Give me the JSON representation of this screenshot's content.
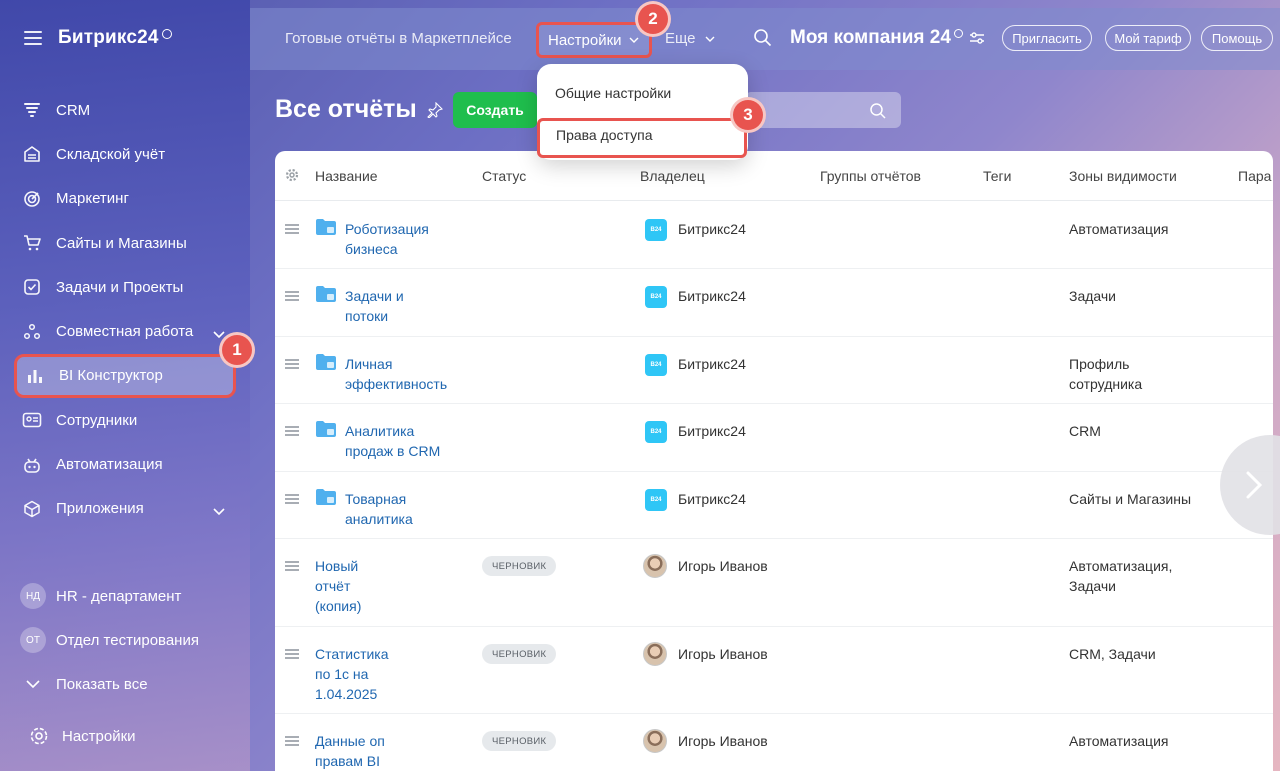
{
  "app": {
    "logo": "Битрикс24"
  },
  "sidebar": {
    "items": [
      {
        "label": "CRM",
        "icon": "crm-icon"
      },
      {
        "label": "Складской учёт",
        "icon": "warehouse-icon"
      },
      {
        "label": "Маркетинг",
        "icon": "marketing-icon"
      },
      {
        "label": "Сайты и Магазины",
        "icon": "cart-icon"
      },
      {
        "label": "Задачи и Проекты",
        "icon": "checkbox-icon"
      },
      {
        "label": "Совместная работа",
        "icon": "collab-icon"
      },
      {
        "label": "BI Конструктор",
        "icon": "bar-chart-icon"
      },
      {
        "label": "Сотрудники",
        "icon": "employees-icon"
      },
      {
        "label": "Автоматизация",
        "icon": "robot-icon"
      },
      {
        "label": "Приложения",
        "icon": "cube-icon"
      }
    ],
    "groups": [
      {
        "initials": "НД",
        "label": "HR - департамент"
      },
      {
        "initials": "ОТ",
        "label": "Отдел тестирования"
      }
    ],
    "show_all": "Показать все",
    "settings": "Настройки"
  },
  "topbar": {
    "marketplace": "Готовые отчёты в Маркетплейсе",
    "settings": "Настройки",
    "more": "Еще",
    "company": "Моя компания 24",
    "invite": "Пригласить",
    "tariff": "Мой тариф",
    "help": "Помощь"
  },
  "main": {
    "title": "Все отчёты",
    "create": "Создать"
  },
  "dropdown": {
    "general": "Общие настройки",
    "access": "Права доступа"
  },
  "callouts": {
    "one": "1",
    "two": "2",
    "three": "3"
  },
  "table": {
    "headers": [
      "Название",
      "Статус",
      "Владелец",
      "Группы отчётов",
      "Теги",
      "Зоны видимости",
      "Пара"
    ],
    "rows": [
      {
        "name_1": "Роботизация",
        "name_2": "бизнеса",
        "owner": "Битрикс24",
        "zone_1": "Автоматизация",
        "zone_2": ""
      },
      {
        "name_1": "Задачи и",
        "name_2": "потоки",
        "owner": "Битрикс24",
        "zone_1": "Задачи",
        "zone_2": ""
      },
      {
        "name_1": "Личная",
        "name_2": "эффективность",
        "owner": "Битрикс24",
        "zone_1": "Профиль",
        "zone_2": "сотрудника"
      },
      {
        "name_1": "Аналитика",
        "name_2": "продаж в CRM",
        "owner": "Битрикс24",
        "zone_1": "CRM",
        "zone_2": ""
      },
      {
        "name_1": "Товарная",
        "name_2": "аналитика",
        "owner": "Битрикс24",
        "zone_1": "Сайты и Магазины",
        "zone_2": ""
      },
      {
        "name_1": "Новый",
        "name_2": "отчёт",
        "name_3": "(копия)",
        "status": "ЧЕРНОВИК",
        "owner": "Игорь Иванов",
        "zone_1": "Автоматизация,",
        "zone_2": "Задачи"
      },
      {
        "name_1": "Статистика",
        "name_2": "по 1с на",
        "name_3": "1.04.2025",
        "status": "ЧЕРНОВИК",
        "owner": "Игорь Иванов",
        "zone_1": "CRM, Задачи",
        "zone_2": ""
      },
      {
        "name_1": "Данные оп",
        "name_2": "правам BI",
        "status": "ЧЕРНОВИК",
        "owner": "Игорь Иванов",
        "zone_1": "Автоматизация",
        "zone_2": ""
      }
    ],
    "b24_badge": "B24"
  },
  "colors": {
    "accent_red": "#e8544f",
    "create_green": "#1fbe4d",
    "link_blue": "#2067b0",
    "b24_blue": "#2fc6f6"
  }
}
